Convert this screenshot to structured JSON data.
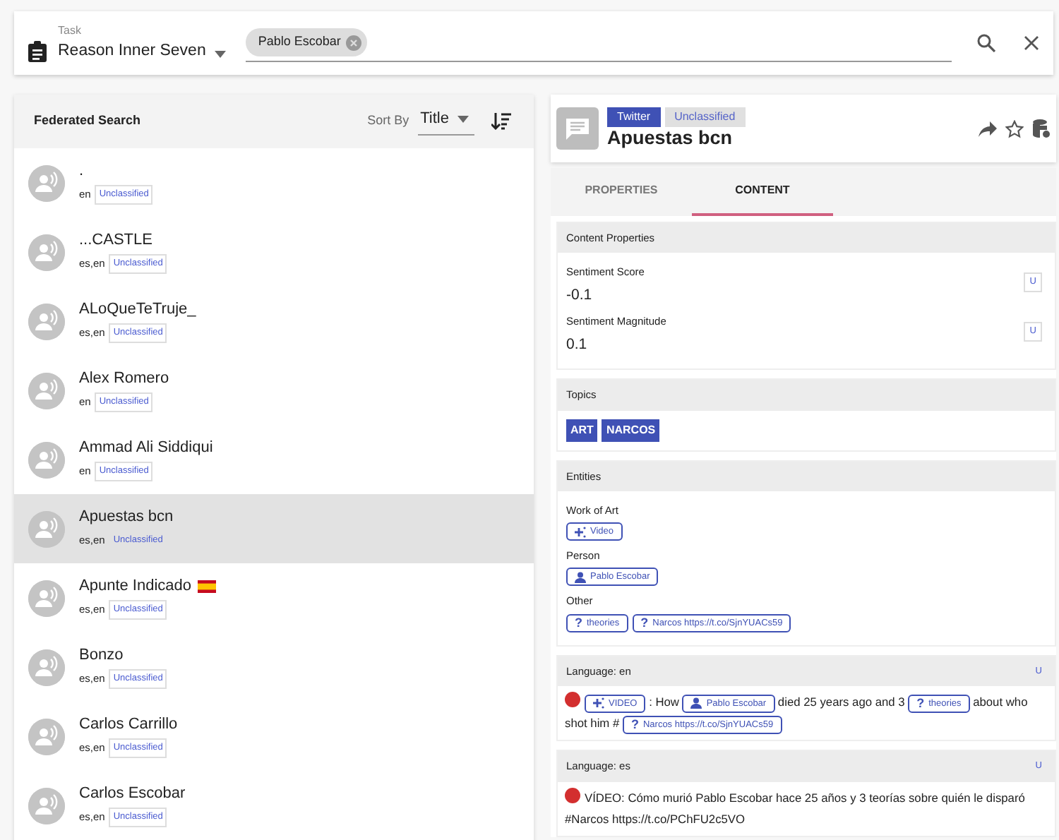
{
  "task": {
    "label": "Task",
    "value": "Reason Inner Seven",
    "chips": [
      {
        "text": "Pablo Escobar"
      }
    ]
  },
  "search": {
    "title": "Federated Search",
    "sort_label": "Sort By",
    "sort_value": "Title",
    "items": [
      {
        "title": ".",
        "langs": "en",
        "classification": "Unclassified",
        "selected": false
      },
      {
        "title": "...CASTLE",
        "langs": "es,en",
        "classification": "Unclassified",
        "selected": false
      },
      {
        "title": "ALoQueTeTruje_",
        "langs": "es,en",
        "classification": "Unclassified",
        "selected": false
      },
      {
        "title": "Alex Romero",
        "langs": "en",
        "classification": "Unclassified",
        "selected": false
      },
      {
        "title": "Ammad Ali Siddiqui",
        "langs": "en",
        "classification": "Unclassified",
        "selected": false
      },
      {
        "title": "Apuestas bcn",
        "langs": "es,en",
        "classification": "Unclassified",
        "selected": true
      },
      {
        "title": "Apunte Indicado",
        "flag": true,
        "langs": "es,en",
        "classification": "Unclassified",
        "selected": false
      },
      {
        "title": "Bonzo",
        "langs": "es,en",
        "classification": "Unclassified",
        "selected": false
      },
      {
        "title": "Carlos Carrillo",
        "langs": "es,en",
        "classification": "Unclassified",
        "selected": false
      },
      {
        "title": "Carlos Escobar",
        "langs": "es,en",
        "classification": "Unclassified",
        "selected": false
      }
    ]
  },
  "detail": {
    "source": "Twitter",
    "classification": "Unclassified",
    "title": "Apuestas bcn",
    "tabs": [
      {
        "label": "PROPERTIES",
        "selected": false
      },
      {
        "label": "CONTENT",
        "selected": true
      }
    ],
    "content_properties": {
      "title": "Content Properties",
      "fields": [
        {
          "label": "Sentiment Score",
          "value": "-0.1",
          "badge": "U"
        },
        {
          "label": "Sentiment Magnitude",
          "value": "0.1",
          "badge": "U"
        }
      ]
    },
    "topics": {
      "title": "Topics",
      "tags": [
        "ART",
        "NARCOS"
      ]
    },
    "entities": {
      "title": "Entities",
      "groups": [
        {
          "label": "Work of Art",
          "items": [
            {
              "kind": "work",
              "text": "Video"
            }
          ]
        },
        {
          "label": "Person",
          "items": [
            {
              "kind": "person",
              "text": "Pablo Escobar"
            }
          ]
        },
        {
          "label": "Other",
          "items": [
            {
              "kind": "other",
              "mark": "?",
              "text": "theories"
            },
            {
              "kind": "other",
              "mark": "?",
              "text": "Narcos https://t.co/SjnYUACs59"
            }
          ]
        }
      ]
    },
    "languages": [
      {
        "title": "Language: en",
        "badge": "U",
        "segments": [
          {
            "kind": "work",
            "text": "VIDEO"
          },
          {
            "kind": "text",
            "text": ": How"
          },
          {
            "kind": "person",
            "text": "Pablo Escobar"
          },
          {
            "kind": "text",
            "text": "died 25 years ago and 3"
          },
          {
            "kind": "other",
            "mark": "?",
            "text": "theories"
          },
          {
            "kind": "text",
            "text": "about who"
          },
          {
            "kind": "text",
            "text": "shot him #"
          },
          {
            "kind": "other",
            "mark": "?",
            "text": "Narcos https://t.co/SjnYUACs59"
          }
        ]
      },
      {
        "title": "Language: es",
        "badge": "U",
        "segments": [
          {
            "kind": "text",
            "text": "VÍDEO: Cómo murió Pablo Escobar hace 25 años y 3 teorías sobre quién le disparó"
          },
          {
            "kind": "text",
            "text": "#Narcos https://t.co/PChFU2c5VO"
          }
        ]
      }
    ]
  }
}
